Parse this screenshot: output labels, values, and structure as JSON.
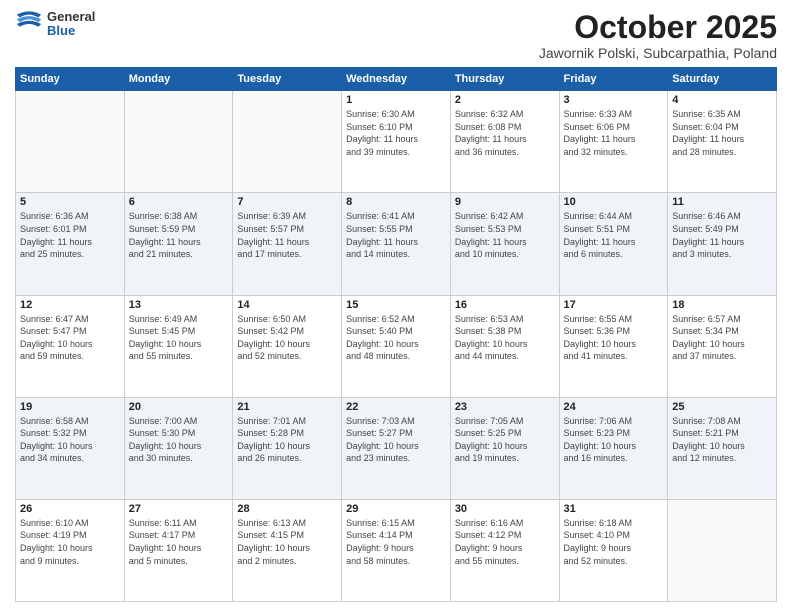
{
  "header": {
    "logo_general": "General",
    "logo_blue": "Blue",
    "title": "October 2025",
    "subtitle": "Jawornik Polski, Subcarpathia, Poland"
  },
  "days_of_week": [
    "Sunday",
    "Monday",
    "Tuesday",
    "Wednesday",
    "Thursday",
    "Friday",
    "Saturday"
  ],
  "weeks": [
    {
      "shaded": false,
      "days": [
        {
          "num": "",
          "info": ""
        },
        {
          "num": "",
          "info": ""
        },
        {
          "num": "",
          "info": ""
        },
        {
          "num": "1",
          "info": "Sunrise: 6:30 AM\nSunset: 6:10 PM\nDaylight: 11 hours\nand 39 minutes."
        },
        {
          "num": "2",
          "info": "Sunrise: 6:32 AM\nSunset: 6:08 PM\nDaylight: 11 hours\nand 36 minutes."
        },
        {
          "num": "3",
          "info": "Sunrise: 6:33 AM\nSunset: 6:06 PM\nDaylight: 11 hours\nand 32 minutes."
        },
        {
          "num": "4",
          "info": "Sunrise: 6:35 AM\nSunset: 6:04 PM\nDaylight: 11 hours\nand 28 minutes."
        }
      ]
    },
    {
      "shaded": true,
      "days": [
        {
          "num": "5",
          "info": "Sunrise: 6:36 AM\nSunset: 6:01 PM\nDaylight: 11 hours\nand 25 minutes."
        },
        {
          "num": "6",
          "info": "Sunrise: 6:38 AM\nSunset: 5:59 PM\nDaylight: 11 hours\nand 21 minutes."
        },
        {
          "num": "7",
          "info": "Sunrise: 6:39 AM\nSunset: 5:57 PM\nDaylight: 11 hours\nand 17 minutes."
        },
        {
          "num": "8",
          "info": "Sunrise: 6:41 AM\nSunset: 5:55 PM\nDaylight: 11 hours\nand 14 minutes."
        },
        {
          "num": "9",
          "info": "Sunrise: 6:42 AM\nSunset: 5:53 PM\nDaylight: 11 hours\nand 10 minutes."
        },
        {
          "num": "10",
          "info": "Sunrise: 6:44 AM\nSunset: 5:51 PM\nDaylight: 11 hours\nand 6 minutes."
        },
        {
          "num": "11",
          "info": "Sunrise: 6:46 AM\nSunset: 5:49 PM\nDaylight: 11 hours\nand 3 minutes."
        }
      ]
    },
    {
      "shaded": false,
      "days": [
        {
          "num": "12",
          "info": "Sunrise: 6:47 AM\nSunset: 5:47 PM\nDaylight: 10 hours\nand 59 minutes."
        },
        {
          "num": "13",
          "info": "Sunrise: 6:49 AM\nSunset: 5:45 PM\nDaylight: 10 hours\nand 55 minutes."
        },
        {
          "num": "14",
          "info": "Sunrise: 6:50 AM\nSunset: 5:42 PM\nDaylight: 10 hours\nand 52 minutes."
        },
        {
          "num": "15",
          "info": "Sunrise: 6:52 AM\nSunset: 5:40 PM\nDaylight: 10 hours\nand 48 minutes."
        },
        {
          "num": "16",
          "info": "Sunrise: 6:53 AM\nSunset: 5:38 PM\nDaylight: 10 hours\nand 44 minutes."
        },
        {
          "num": "17",
          "info": "Sunrise: 6:55 AM\nSunset: 5:36 PM\nDaylight: 10 hours\nand 41 minutes."
        },
        {
          "num": "18",
          "info": "Sunrise: 6:57 AM\nSunset: 5:34 PM\nDaylight: 10 hours\nand 37 minutes."
        }
      ]
    },
    {
      "shaded": true,
      "days": [
        {
          "num": "19",
          "info": "Sunrise: 6:58 AM\nSunset: 5:32 PM\nDaylight: 10 hours\nand 34 minutes."
        },
        {
          "num": "20",
          "info": "Sunrise: 7:00 AM\nSunset: 5:30 PM\nDaylight: 10 hours\nand 30 minutes."
        },
        {
          "num": "21",
          "info": "Sunrise: 7:01 AM\nSunset: 5:28 PM\nDaylight: 10 hours\nand 26 minutes."
        },
        {
          "num": "22",
          "info": "Sunrise: 7:03 AM\nSunset: 5:27 PM\nDaylight: 10 hours\nand 23 minutes."
        },
        {
          "num": "23",
          "info": "Sunrise: 7:05 AM\nSunset: 5:25 PM\nDaylight: 10 hours\nand 19 minutes."
        },
        {
          "num": "24",
          "info": "Sunrise: 7:06 AM\nSunset: 5:23 PM\nDaylight: 10 hours\nand 16 minutes."
        },
        {
          "num": "25",
          "info": "Sunrise: 7:08 AM\nSunset: 5:21 PM\nDaylight: 10 hours\nand 12 minutes."
        }
      ]
    },
    {
      "shaded": false,
      "days": [
        {
          "num": "26",
          "info": "Sunrise: 6:10 AM\nSunset: 4:19 PM\nDaylight: 10 hours\nand 9 minutes."
        },
        {
          "num": "27",
          "info": "Sunrise: 6:11 AM\nSunset: 4:17 PM\nDaylight: 10 hours\nand 5 minutes."
        },
        {
          "num": "28",
          "info": "Sunrise: 6:13 AM\nSunset: 4:15 PM\nDaylight: 10 hours\nand 2 minutes."
        },
        {
          "num": "29",
          "info": "Sunrise: 6:15 AM\nSunset: 4:14 PM\nDaylight: 9 hours\nand 58 minutes."
        },
        {
          "num": "30",
          "info": "Sunrise: 6:16 AM\nSunset: 4:12 PM\nDaylight: 9 hours\nand 55 minutes."
        },
        {
          "num": "31",
          "info": "Sunrise: 6:18 AM\nSunset: 4:10 PM\nDaylight: 9 hours\nand 52 minutes."
        },
        {
          "num": "",
          "info": ""
        }
      ]
    }
  ]
}
